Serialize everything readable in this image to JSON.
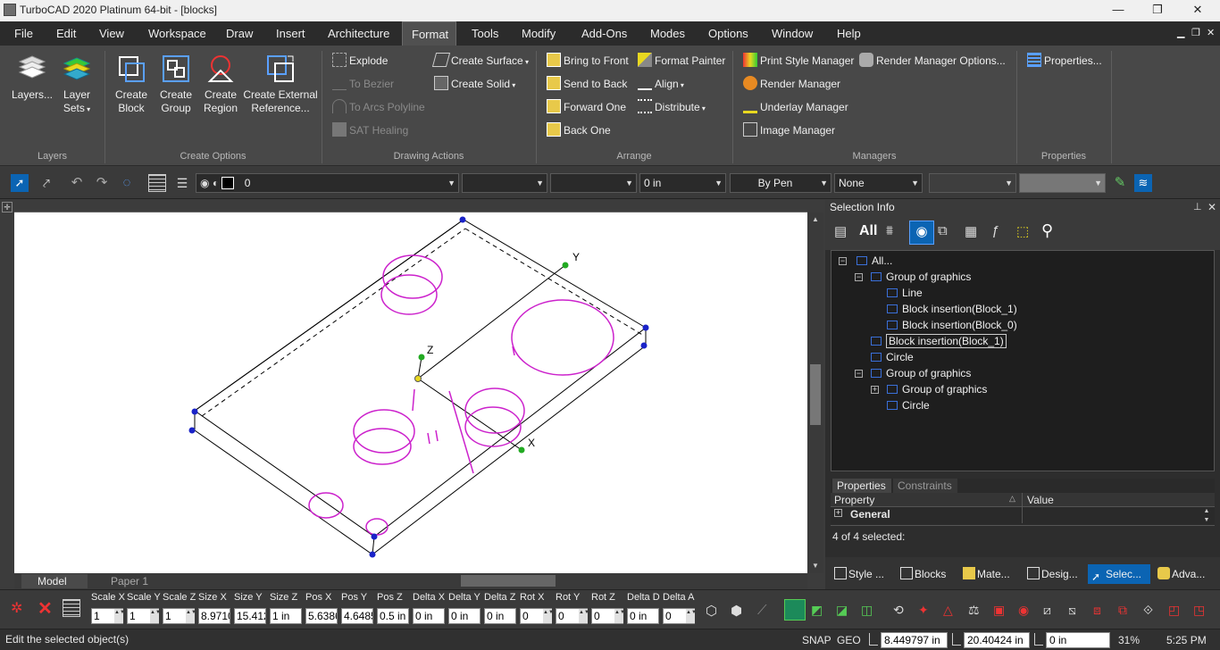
{
  "window": {
    "title": "TurboCAD 2020 Platinum 64-bit - [blocks]",
    "minimize": "—",
    "restore": "❐",
    "close": "✕"
  },
  "menu": [
    "File",
    "Edit",
    "View",
    "Workspace",
    "Draw",
    "Insert",
    "Architecture",
    "Format",
    "Tools",
    "Modify",
    "Add-Ons",
    "Modes",
    "Options",
    "Window",
    "Help"
  ],
  "menu_active": "Format",
  "ribbon": {
    "layers": {
      "label": "Layers",
      "btn_layers": "Layers...",
      "btn_layer_sets_1": "Layer",
      "btn_layer_sets_2": "Sets"
    },
    "create_options": {
      "label": "Create Options",
      "create_block_1": "Create",
      "create_block_2": "Block",
      "create_group_1": "Create",
      "create_group_2": "Group",
      "create_region_1": "Create",
      "create_region_2": "Region",
      "create_ext_1": "Create External",
      "create_ext_2": "Reference..."
    },
    "drawing_actions": {
      "label": "Drawing Actions",
      "explode": "Explode",
      "to_bezier": "To Bezier",
      "to_arcs": "To Arcs Polyline",
      "sat_healing": "SAT Healing",
      "create_surface": "Create Surface",
      "create_solid": "Create Solid"
    },
    "arrange": {
      "label": "Arrange",
      "bring_front": "Bring to Front",
      "send_back": "Send to Back",
      "forward_one": "Forward One",
      "back_one": "Back One",
      "format_painter": "Format Painter",
      "align": "Align",
      "distribute": "Distribute"
    },
    "managers": {
      "label": "Managers",
      "print_style": "Print Style Manager",
      "render_manager": "Render Manager",
      "underlay": "Underlay Manager",
      "image_manager": "Image Manager",
      "render_options": "Render Manager Options..."
    },
    "properties": {
      "label": "Properties",
      "btn": "Properties..."
    }
  },
  "prop_toolbar": {
    "layer_value": "0",
    "thickness": "0 in",
    "pen": "By Pen",
    "fill": "None"
  },
  "drawing_tabs": {
    "model": "Model",
    "paper": "Paper 1"
  },
  "selection_info": {
    "title": "Selection Info",
    "all_label": "All",
    "tree": [
      {
        "label": "All...",
        "level": 0,
        "exp": "−"
      },
      {
        "label": "Group of graphics",
        "level": 1,
        "exp": "−"
      },
      {
        "label": "Line",
        "level": 2,
        "exp": ""
      },
      {
        "label": "Block insertion(Block_1)",
        "level": 2,
        "exp": ""
      },
      {
        "label": "Block insertion(Block_0)",
        "level": 2,
        "exp": ""
      },
      {
        "label": "Block insertion(Block_1)",
        "level": 1,
        "exp": ""
      },
      {
        "label": "Circle",
        "level": 1,
        "exp": ""
      },
      {
        "label": "Group of graphics",
        "level": 1,
        "exp": "−"
      },
      {
        "label": "Group of graphics",
        "level": 2,
        "exp": "+"
      },
      {
        "label": "Circle",
        "level": 2,
        "exp": ""
      }
    ],
    "props_tab": "Properties",
    "constraints_tab": "Constraints",
    "col_property": "Property",
    "col_value": "Value",
    "general": "General",
    "selected_count": "4 of 4 selected:"
  },
  "panel_tabs": [
    "Style ...",
    "Blocks",
    "Mate...",
    "Desig...",
    "Selec...",
    "Adva..."
  ],
  "panel_tab_active": "Selec...",
  "inspector": [
    {
      "label": "Scale X",
      "value": "1",
      "spin": true
    },
    {
      "label": "Scale Y",
      "value": "1",
      "spin": true
    },
    {
      "label": "Scale Z",
      "value": "1",
      "spin": true
    },
    {
      "label": "Size X",
      "value": "8.9710",
      "spin": false
    },
    {
      "label": "Size Y",
      "value": "15.412",
      "spin": false
    },
    {
      "label": "Size Z",
      "value": "1 in",
      "spin": false
    },
    {
      "label": "Pos X",
      "value": "5.6386",
      "spin": false
    },
    {
      "label": "Pos Y",
      "value": "4.6485",
      "spin": false
    },
    {
      "label": "Pos Z",
      "value": "0.5 in",
      "spin": false
    },
    {
      "label": "Delta X",
      "value": "0 in",
      "spin": false
    },
    {
      "label": "Delta Y",
      "value": "0 in",
      "spin": false
    },
    {
      "label": "Delta Z",
      "value": "0 in",
      "spin": false
    },
    {
      "label": "Rot X",
      "value": "0",
      "spin": true
    },
    {
      "label": "Rot Y",
      "value": "0",
      "spin": true
    },
    {
      "label": "Rot Z",
      "value": "0",
      "spin": true
    },
    {
      "label": "Delta D",
      "value": "0 in",
      "spin": false
    },
    {
      "label": "Delta A",
      "value": "0",
      "spin": true
    }
  ],
  "status": {
    "message": "Edit the selected object(s)",
    "snap": "SNAP",
    "geo": "GEO",
    "x": "8.449797 in",
    "y": "20.40424 in",
    "z": "0 in",
    "zoom": "31%",
    "time": "5:25 PM"
  },
  "colors": {
    "accent": "#0b64b3",
    "drawing_magenta": "#cc22cc",
    "handle_blue": "#1a23c8",
    "handle_green": "#22aa22"
  },
  "axis_labels": {
    "y": "Y",
    "z": "Z",
    "x": "X"
  }
}
